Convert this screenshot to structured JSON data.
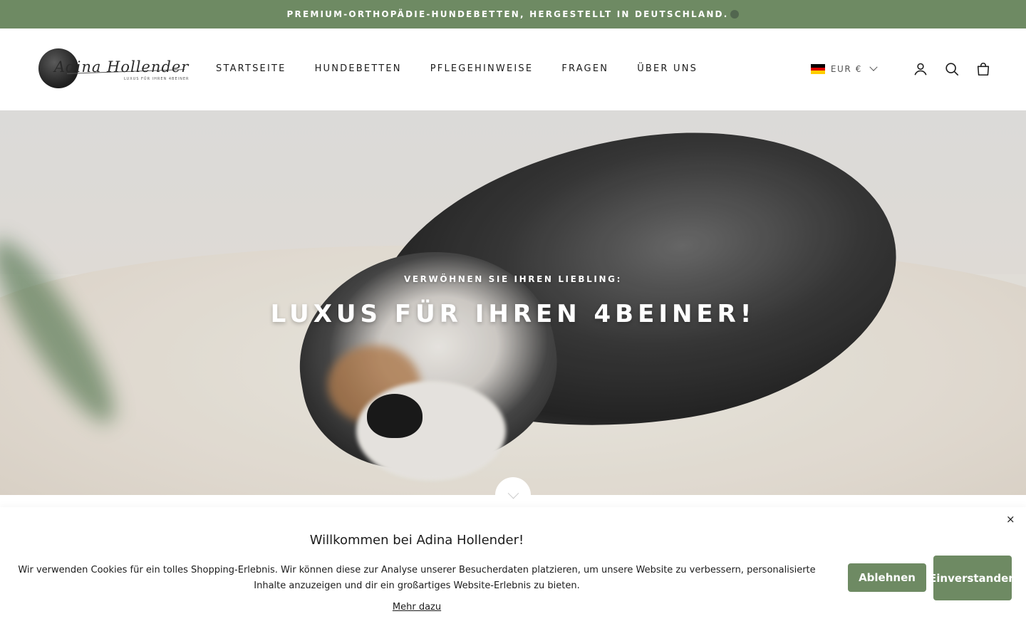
{
  "announcement": {
    "text": "PREMIUM-ORTHOPÄDIE-HUNDEBETTEN, HERGESTELLT IN DEUTSCHLAND."
  },
  "header": {
    "logo": {
      "script": "Adina Hollender",
      "tagline": "LUXUS FÜR IHREN 4BEINER"
    },
    "nav": [
      {
        "label": "STARTSEITE"
      },
      {
        "label": "HUNDEBETTEN"
      },
      {
        "label": "PFLEGEHINWEISE"
      },
      {
        "label": "FRAGEN"
      },
      {
        "label": "ÜBER UNS"
      }
    ],
    "currency": {
      "label": "EUR €",
      "flag_colors": [
        "#000000",
        "#dd0000",
        "#ffce00"
      ]
    },
    "icons": [
      "account-icon",
      "search-icon",
      "cart-icon"
    ]
  },
  "hero": {
    "subtitle": "VERWÖHNEN SIE IHREN LIEBLING:",
    "title": "LUXUS FÜR IHREN 4BEINER!"
  },
  "cookie_banner": {
    "title": "Willkommen bei Adina Hollender!",
    "text": "Wir verwenden Cookies für ein tolles Shopping-Erlebnis. Wir können diese zur Analyse unserer Besucherdaten platzieren, um unsere Website zu verbessern, personalisierte Inhalte anzuzeigen und dir ein großartiges Website-Erlebnis zu bieten.",
    "more_link": "Mehr dazu",
    "decline_label": "Ablehnen",
    "accept_label": "Einverstanden",
    "close_symbol": "×"
  },
  "colors": {
    "accent": "#6e8a63",
    "text": "#1c1c1c"
  }
}
